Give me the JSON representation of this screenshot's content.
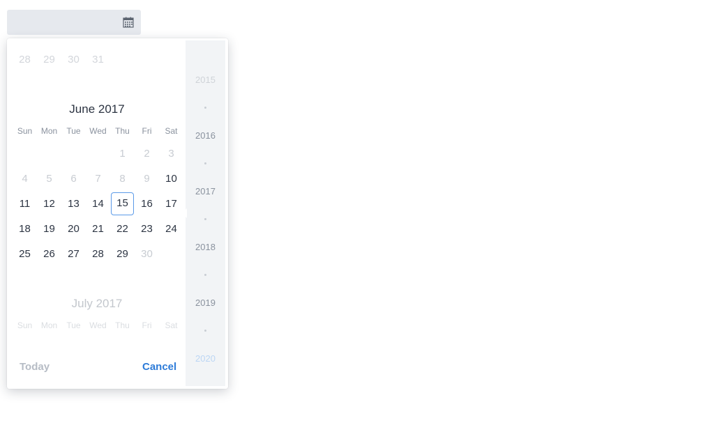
{
  "datepicker": {
    "input_value": "",
    "calendar_icon": "calendar-icon",
    "prev_tail_days": [
      "28",
      "29",
      "30",
      "31"
    ],
    "current_month": {
      "title": "June 2017",
      "weekdays": [
        "Sun",
        "Mon",
        "Tue",
        "Wed",
        "Thu",
        "Fri",
        "Sat"
      ],
      "weeks": [
        [
          "",
          "",
          "",
          "",
          "1",
          "2",
          "3"
        ],
        [
          "4",
          "5",
          "6",
          "7",
          "8",
          "9",
          "10"
        ],
        [
          "11",
          "12",
          "13",
          "14",
          "15",
          "16",
          "17"
        ],
        [
          "18",
          "19",
          "20",
          "21",
          "22",
          "23",
          "24"
        ],
        [
          "25",
          "26",
          "27",
          "28",
          "29",
          "30",
          ""
        ]
      ],
      "selected_day": "15"
    },
    "next_month": {
      "title": "July 2017",
      "weekdays": [
        "Sun",
        "Mon",
        "Tue",
        "Wed",
        "Thu",
        "Fri",
        "Sat"
      ]
    },
    "years": [
      "2015",
      "2016",
      "2017",
      "2018",
      "2019",
      "2020"
    ],
    "footer": {
      "today_label": "Today",
      "cancel_label": "Cancel"
    },
    "colors": {
      "accent": "#2d7bd8",
      "selected_border": "#5b9ae8",
      "input_bg": "#e6e9ee",
      "year_column_bg": "#f2f4f6"
    }
  }
}
